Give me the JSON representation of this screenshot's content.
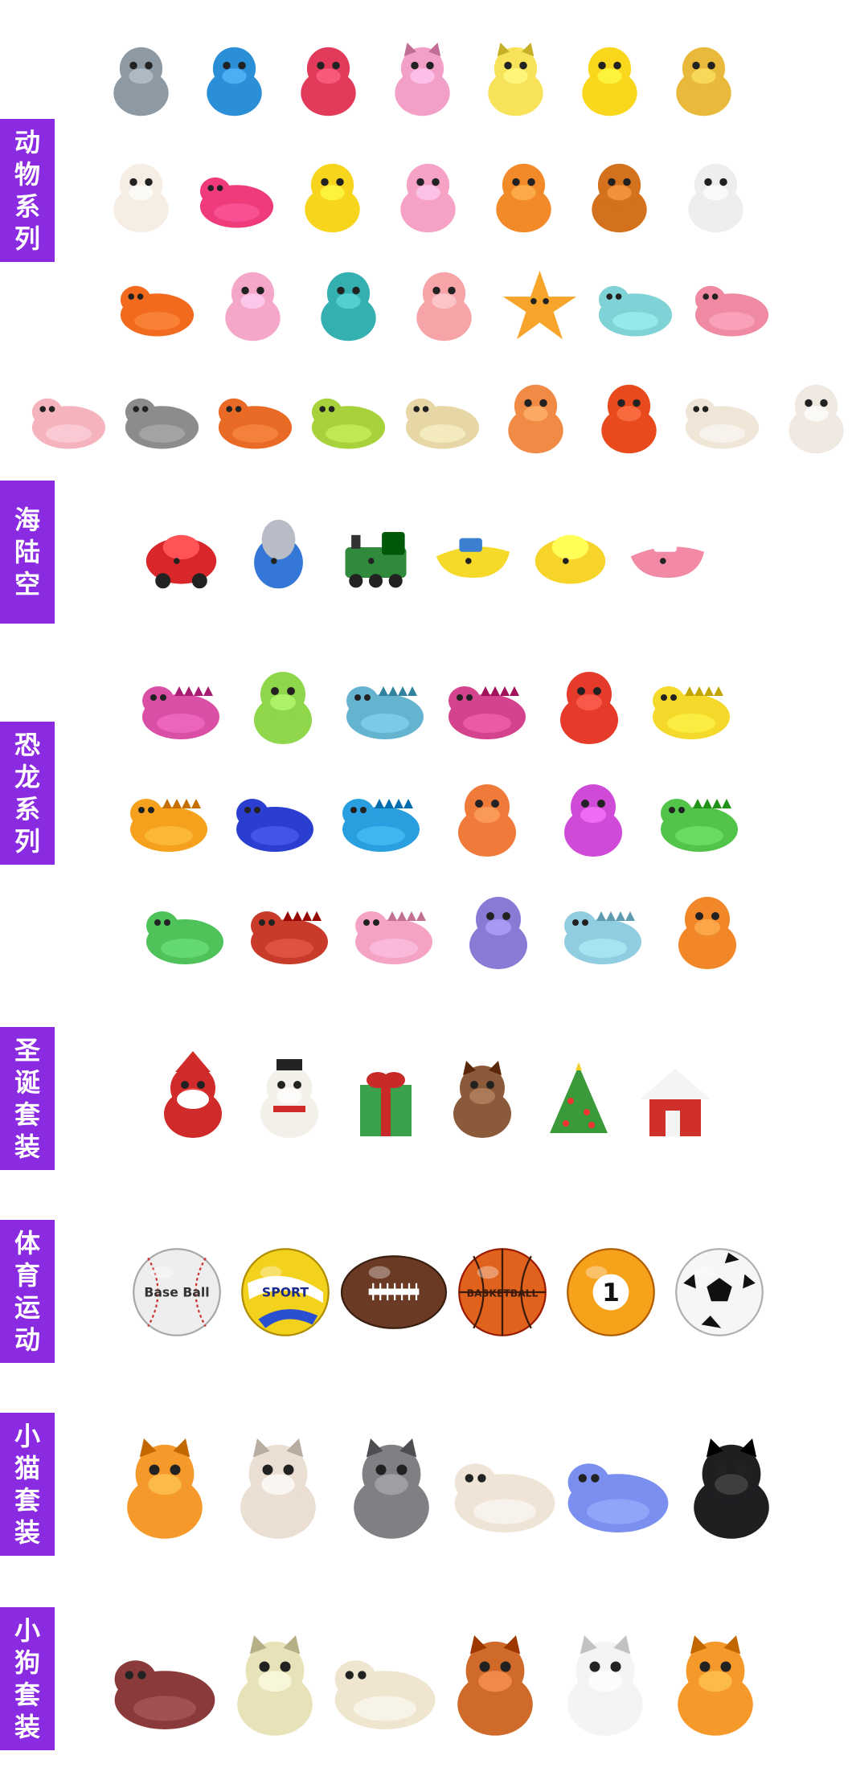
{
  "categories": [
    {
      "id": "animal",
      "label": [
        "动",
        "物",
        "系",
        "列"
      ],
      "name": "动物系列",
      "rows": [
        [
          "shark-grey",
          "shark-blue",
          "mermaid",
          "owl-pink",
          "owl-yellow",
          "duck-yellow-round",
          "giraffe"
        ],
        [
          "llama",
          "flamingo",
          "duck-yellow",
          "poop-pink",
          "lion-orange",
          "lion-brown",
          "zebra"
        ],
        [
          "clownfish",
          "unicorn-pink",
          "unicorn-teal",
          "octopus-pink",
          "starfish",
          "elephant",
          "hippo-pink"
        ],
        [
          "pig",
          "donkey",
          "cow-orange",
          "frog",
          "sheep",
          "hamster",
          "rooster",
          "goose",
          "rabbit"
        ]
      ]
    },
    {
      "id": "vehicle",
      "label": [
        "海",
        "陆",
        "空"
      ],
      "name": "海陆空",
      "rows": [
        [
          "car-red",
          "rocket",
          "train-green",
          "boat-yellow",
          "submarine",
          "plane-pink"
        ]
      ]
    },
    {
      "id": "dino",
      "label": [
        "恐",
        "龙",
        "系",
        "列"
      ],
      "name": "恐龙系列",
      "rows": [
        [
          "dino-pink-spiked",
          "dino-green",
          "dino-longneck-teal",
          "dino-triceratops-pink",
          "dino-red",
          "dino-yellow-spiked"
        ],
        [
          "dino-orange-spotted",
          "croc-blue",
          "dino-longneck-blue",
          "dino-orange-crest",
          "dino-pink-crest",
          "dino-green-crawl"
        ],
        [
          "dino-green-stego",
          "dino-red-longneck",
          "dino-pink-pterodactyl",
          "dino-purple-trex",
          "dino-duck-teal",
          "dino-orange-sitting"
        ]
      ]
    },
    {
      "id": "xmas",
      "label": [
        "圣",
        "诞",
        "套",
        "装"
      ],
      "name": "圣诞套装",
      "rows": [
        [
          "santa",
          "snowman",
          "gift-box",
          "reindeer",
          "xmas-tree",
          "house-snow"
        ]
      ]
    },
    {
      "id": "sport",
      "label": [
        "体",
        "育",
        "运",
        "动"
      ],
      "name": "体育运动",
      "rows": [
        [
          "baseball",
          "volleyball",
          "football",
          "basketball",
          "billiard-ball",
          "soccer-ball"
        ]
      ],
      "ball_text": {
        "baseball": "Base Ball",
        "volleyball": "SPORT",
        "basketball": "BASKETBALL",
        "billiard": "1"
      }
    },
    {
      "id": "cat",
      "label": [
        "小",
        "猫",
        "套",
        "装"
      ],
      "name": "小猫套装",
      "rows": [
        [
          "cat-orange",
          "cat-white",
          "cat-grey",
          "cat-calico",
          "cat-blue",
          "cat-black"
        ]
      ]
    },
    {
      "id": "dog",
      "label": [
        "小",
        "狗",
        "套",
        "装"
      ],
      "name": "小狗套装",
      "rows": [
        [
          "dog-brown",
          "dog-poodle",
          "dog-puppy-cream",
          "dog-shepherd",
          "dog-dalmatian",
          "dog-corgi"
        ]
      ]
    }
  ],
  "colors": {
    "label_bg": "#8a2be2",
    "label_text": "#ffffff",
    "page_bg": "#ffffff"
  },
  "toy_colors": {
    "shark-grey": "#8e9aa3",
    "shark-blue": "#2b8fd8",
    "mermaid": "#e23a5a",
    "owl-pink": "#f3a0c8",
    "owl-yellow": "#f8e25a",
    "duck-yellow-round": "#f8d71c",
    "giraffe": "#e8b93a",
    "llama": "#f6ede4",
    "flamingo": "#ef3a7c",
    "duck-yellow": "#f7d51d",
    "poop-pink": "#f6a2c6",
    "lion-orange": "#f28a2a",
    "lion-brown": "#d4711c",
    "zebra": "#eeeeee",
    "clownfish": "#f26a1e",
    "unicorn-pink": "#f4a7c8",
    "unicorn-teal": "#34b0b0",
    "octopus-pink": "#f7a4a9",
    "starfish": "#f6a52a",
    "elephant": "#7fd2d6",
    "hippo-pink": "#f08aa2",
    "pig": "#f5b3bd",
    "donkey": "#8c8c8c",
    "cow-orange": "#e96a25",
    "frog": "#a8d23b",
    "sheep": "#e7d6a6",
    "hamster": "#f18a44",
    "rooster": "#e84a1e",
    "goose": "#efe6d8",
    "rabbit": "#efe9e1",
    "car-red": "#d8262a",
    "rocket": "#3477d6",
    "train-green": "#2f8a3b",
    "boat-yellow": "#f5da2a",
    "submarine": "#f6d42a",
    "plane-pink": "#f28aa6",
    "dino-pink-spiked": "#d94fa6",
    "dino-green": "#8ed64a",
    "dino-longneck-teal": "#64b4d0",
    "dino-triceratops-pink": "#d4448e",
    "dino-red": "#e63a2a",
    "dino-yellow-spiked": "#f5d92a",
    "dino-orange-spotted": "#f6a11e",
    "croc-blue": "#2a3fd0",
    "dino-longneck-blue": "#2a9fe0",
    "dino-orange-crest": "#f07a3a",
    "dino-pink-crest": "#d04ad8",
    "dino-green-crawl": "#52c44a",
    "dino-green-stego": "#4fc25a",
    "dino-red-longneck": "#c83a2a",
    "dino-pink-pterodactyl": "#f5a3c4",
    "dino-purple-trex": "#8a7ad6",
    "dino-duck-teal": "#90cde0",
    "dino-orange-sitting": "#f2872a",
    "santa": "#d02a2a",
    "snowman": "#f3f0ea",
    "gift-box": "#3aa04a",
    "reindeer": "#8b5a3a",
    "xmas-tree": "#3a9a3a",
    "house-snow": "#d0302a",
    "baseball": "#eeeeee",
    "volleyball": "#f3d21e",
    "football": "#6b3a24",
    "basketball": "#e0621c",
    "billiard-ball": "#f6a21a",
    "soccer-ball": "#f6f6f6",
    "cat-orange": "#f59a2a",
    "cat-white": "#eadfd2",
    "cat-grey": "#7f8083",
    "cat-calico": "#efe4d6",
    "cat-blue": "#7a8ff0",
    "cat-black": "#1f1f22",
    "dog-brown": "#8a3a3a",
    "dog-poodle": "#e8e2b8",
    "dog-puppy-cream": "#f0e6d0",
    "dog-shepherd": "#d06a2a",
    "dog-dalmatian": "#f4f4f4",
    "dog-corgi": "#f59a2a"
  }
}
